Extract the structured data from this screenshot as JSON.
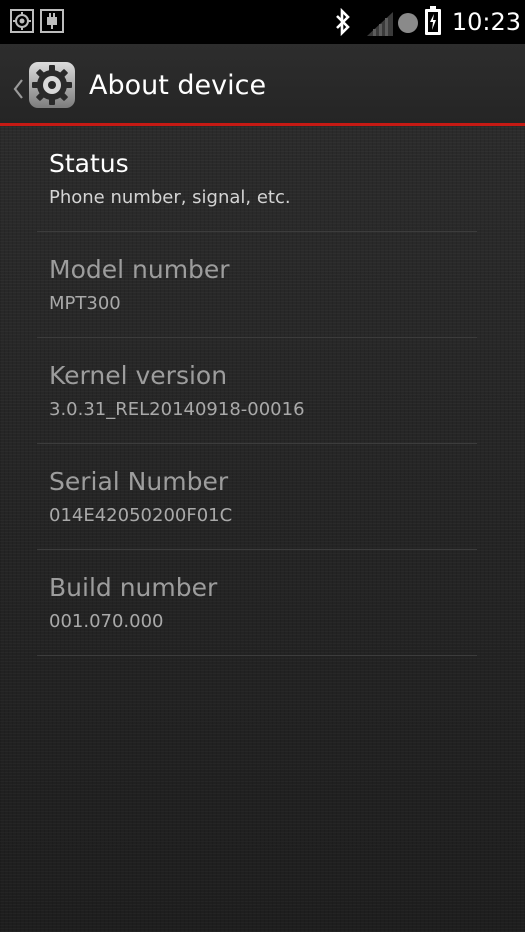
{
  "status_bar": {
    "time": "10:23",
    "left_icons": [
      "gps-icon",
      "usb-icon"
    ],
    "right_icons": [
      "bluetooth-icon",
      "signal-icon",
      "sync-icon",
      "battery-charging-icon"
    ]
  },
  "action_bar": {
    "title": "About device",
    "icon": "settings-gear-icon",
    "accent_color": "#c61a14"
  },
  "preferences": [
    {
      "title": "Status",
      "summary": "Phone number, signal, etc.",
      "enabled": true
    },
    {
      "title": "Model number",
      "summary": "MPT300",
      "enabled": false
    },
    {
      "title": "Kernel version",
      "summary": "3.0.31_REL20140918-00016",
      "enabled": false
    },
    {
      "title": "Serial Number",
      "summary": "014E42050200F01C",
      "enabled": false
    },
    {
      "title": "Build number",
      "summary": "001.070.000",
      "enabled": false
    }
  ]
}
